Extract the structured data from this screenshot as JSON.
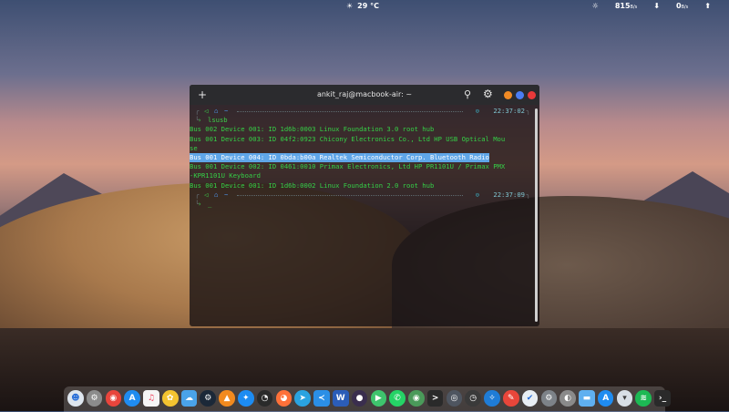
{
  "topbar": {
    "weather_icon": "sun-icon",
    "temperature": "29 °C",
    "brightness_icon": "brightness-icon",
    "download_speed": "815",
    "download_unit": "B/s",
    "download_icon": "down-arrow-icon",
    "upload_speed": "0",
    "upload_unit": "B/s",
    "upload_icon": "up-arrow-icon"
  },
  "terminal": {
    "title": "ankit_raj@macbook-air: ~",
    "prompt_dir": "~",
    "prompt_1_time": "22:37:02",
    "command": "lsusb",
    "output": [
      "Bus 002 Device 001: ID 1d6b:0003 Linux Foundation 3.0 root hub",
      "Bus 001 Device 003: ID 04f2:0923 Chicony Electronics Co., Ltd HP USB Optical Mou",
      "se",
      "Bus 001 Device 004: ID 0bda:b00a Realtek Semiconductor Corp. Bluetooth Radio",
      "Bus 001 Device 002: ID 0461:0010 Primax Electronics, Ltd HP PR1101U / Primax PMX",
      "-KPR1101U Keyboard",
      "Bus 001 Device 001: ID 1d6b:0002 Linux Foundation 2.0 root hub"
    ],
    "highlighted_index": 3,
    "prompt_2_time": "22:37:09",
    "cursor": "_",
    "colors": {
      "green": "#35d047",
      "highlight": "#5fa6e8",
      "orange": "#f08a24",
      "blue": "#4a7cf2",
      "red": "#e8393a"
    }
  },
  "dock": {
    "icons": [
      "finder-icon",
      "settings-icon",
      "chrome-icon",
      "app-store-icon",
      "music-icon",
      "photos-icon",
      "weather-icon",
      "steam-icon",
      "vlc-icon",
      "xcode-icon",
      "dashboard-icon",
      "firefox-icon",
      "telegram-icon",
      "vscode-icon",
      "word-icon",
      "obs-icon",
      "play-icon",
      "whatsapp-icon",
      "chrome-dev-icon",
      "terminal-icon",
      "disk-icon",
      "timer-icon",
      "safari-icon",
      "pen-icon",
      "check-icon",
      "preferences-icon",
      "toggle-icon",
      "folder-icon",
      "app-store-2-icon",
      "trash-icon",
      "spotify-icon",
      "terminal-2-icon"
    ]
  }
}
